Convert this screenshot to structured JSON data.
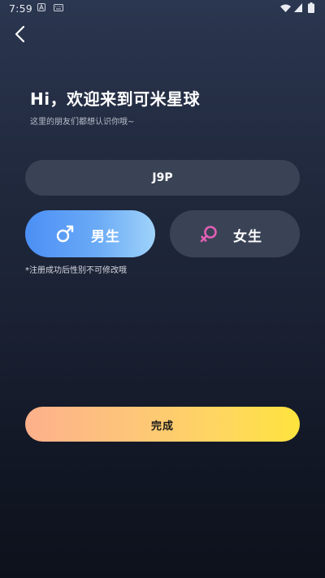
{
  "status_bar": {
    "time": "7:59",
    "icons": [
      "a-notification-icon",
      "keyboard-icon",
      "wifi-icon",
      "signal-icon",
      "battery-icon"
    ]
  },
  "header": {
    "back_icon": "chevron-left-icon"
  },
  "welcome": {
    "title": "Hi，欢迎来到可米星球",
    "subtitle": "这里的朋友们都想认识你哦~"
  },
  "nickname": {
    "value": "J9P"
  },
  "gender": {
    "male": {
      "label": "男生",
      "icon": "male-symbol-icon",
      "selected": true
    },
    "female": {
      "label": "女生",
      "icon": "female-symbol-icon",
      "selected": false
    },
    "note": "*注册成功后性别不可修改哦"
  },
  "actions": {
    "finish_label": "完成"
  },
  "colors": {
    "background_top": "#2b3650",
    "background_bottom": "#0d111b",
    "field_bg": "#3a4356",
    "male_gradient_start": "#4b8ff5",
    "male_gradient_end": "#9fd3fa",
    "female_icon": "#e05fb4",
    "finish_gradient_start": "#fdb08c",
    "finish_gradient_end": "#fee33d"
  }
}
